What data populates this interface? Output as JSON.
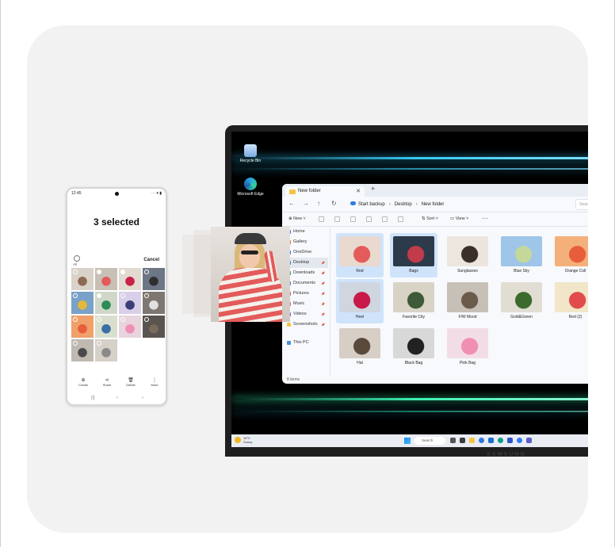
{
  "colors": {
    "card_bg": "#f2f2f2",
    "accent": "#36c9f2",
    "selection": "#cfe3fb"
  },
  "phone": {
    "status_time": "12:45",
    "status_icons": "⋯ ▾ ▮",
    "title": "3 selected",
    "all_label": "All",
    "cancel_label": "Cancel",
    "toolbar": [
      {
        "icon": "create-icon",
        "glyph": "⊕",
        "label": "Create"
      },
      {
        "icon": "share-icon",
        "glyph": "⋖",
        "label": "Share"
      },
      {
        "icon": "trash-icon",
        "glyph": "🗑",
        "label": "Delete"
      },
      {
        "icon": "more-icon",
        "glyph": "⋮",
        "label": "More"
      }
    ],
    "nav": [
      "|||",
      "○",
      "‹"
    ]
  },
  "laptop": {
    "desktop_icons": [
      {
        "label": "Recycle Bin",
        "icon": "recycle-bin-icon"
      },
      {
        "label": "Microsoft Edge",
        "icon": "edge-icon"
      }
    ],
    "explorer": {
      "tab_title": "New folder",
      "breadcrumb": [
        "Start backup",
        "Desktop",
        "New folder"
      ],
      "search_placeholder": "Searc",
      "command_bar": {
        "new_label": "New",
        "sort_label": "Sort",
        "view_label": "View",
        "more_label": "···"
      },
      "nav_items": [
        {
          "label": "Home",
          "selected": false
        },
        {
          "label": "Gallery",
          "selected": false
        },
        {
          "label": "OneDrive",
          "selected": false
        },
        {
          "label": "Desktop",
          "selected": true
        },
        {
          "label": "Downloads",
          "selected": false
        },
        {
          "label": "Documents",
          "selected": false
        },
        {
          "label": "Pictures",
          "selected": false
        },
        {
          "label": "Music",
          "selected": false
        },
        {
          "label": "Videos",
          "selected": false
        },
        {
          "label": "Screenshots",
          "selected": false
        }
      ],
      "this_pc_label": "This PC",
      "status_text": "8 items",
      "files": [
        {
          "name": "Red",
          "selected": true
        },
        {
          "name": "Bags",
          "selected": true
        },
        {
          "name": "Sunglasses",
          "selected": false
        },
        {
          "name": "Blue Sky",
          "selected": false
        },
        {
          "name": "Orange Coll",
          "selected": false
        },
        {
          "name": "Heel",
          "selected": true
        },
        {
          "name": "Favorite City",
          "selected": false
        },
        {
          "name": "F/W Mood",
          "selected": false
        },
        {
          "name": "Gold&Green",
          "selected": false
        },
        {
          "name": "Red (2)",
          "selected": false
        },
        {
          "name": "Hat",
          "selected": false
        },
        {
          "name": "Black Bag",
          "selected": false
        },
        {
          "name": "Pink Bag",
          "selected": false
        }
      ]
    },
    "taskbar": {
      "weather_temp": "18°C",
      "weather_desc": "Sunny",
      "search_label": "Search"
    },
    "brand": "SAMSUNG"
  }
}
